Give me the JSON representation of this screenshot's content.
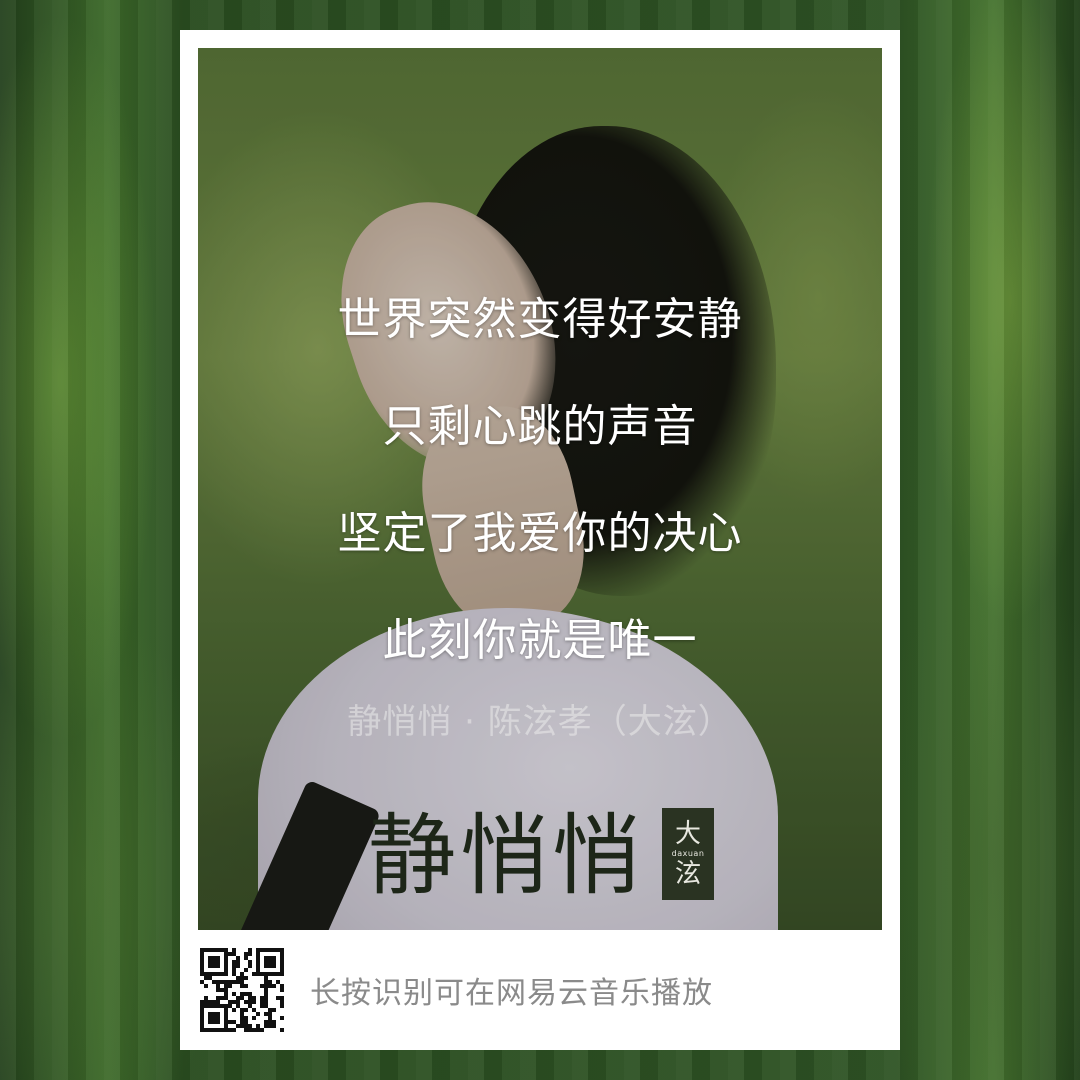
{
  "lyrics": [
    "世界突然变得好安静",
    "只剩心跳的声音",
    "坚定了我爱你的决心",
    "此刻你就是唯一"
  ],
  "credit": "静悄悄 · 陈泫孝（大泫）",
  "album": {
    "title": "静悄悄",
    "seal_top": "大",
    "seal_roman": "daxuan",
    "seal_bottom": "泫"
  },
  "footer": {
    "hint": "长按识别可在网易云音乐播放",
    "qr_icon": "qr-code-icon"
  },
  "colors": {
    "card": "#ffffff",
    "lyric_text": "#ffffff",
    "hint_text": "#8a8a8a",
    "seal_bg": "#2a3322"
  }
}
